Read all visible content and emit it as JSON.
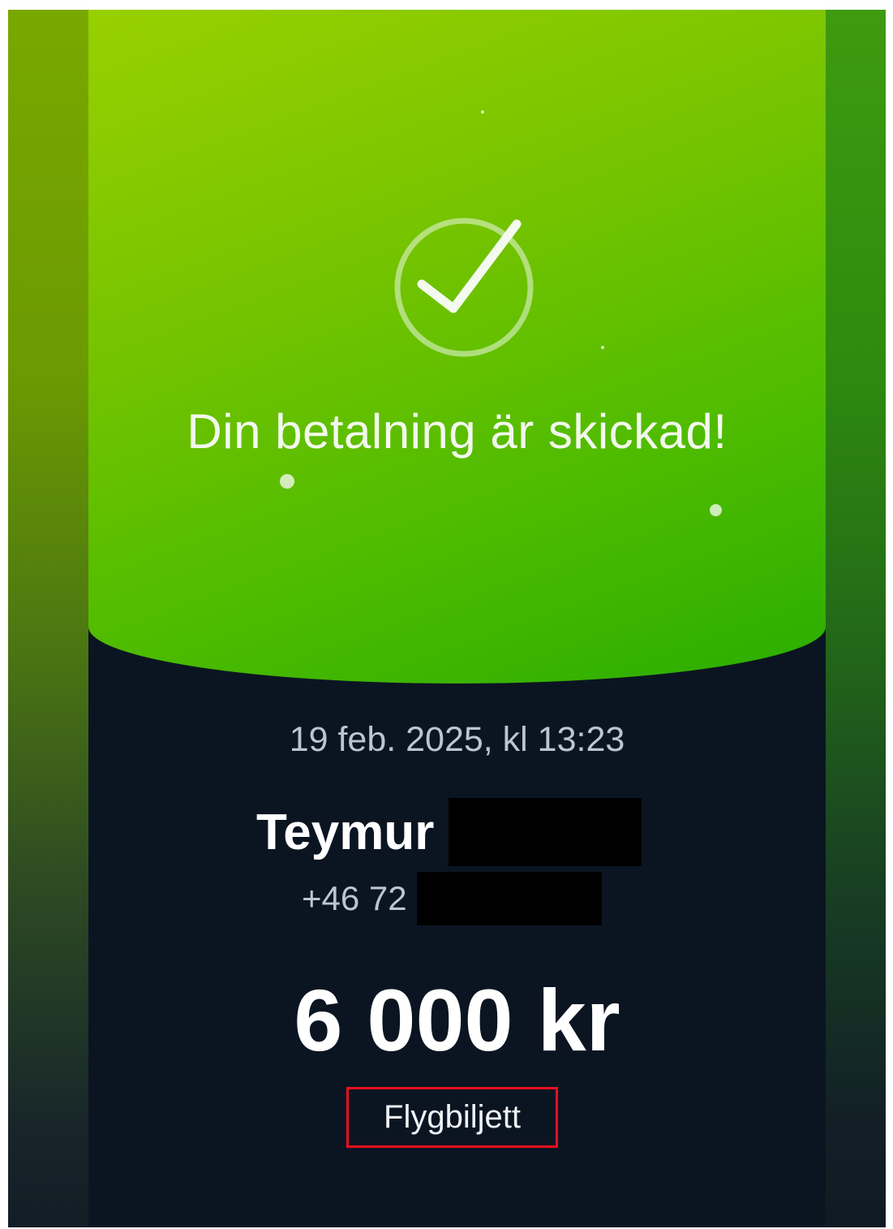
{
  "status": {
    "title": "Din betalning är skickad!",
    "icon": "checkmark-circle-icon"
  },
  "payment": {
    "datetime": "19 feb. 2025, kl 13:23",
    "recipient_first_name": "Teymur",
    "phone_prefix": "+46 72",
    "amount": "6 000 kr",
    "message": "Flygbiljett"
  },
  "colors": {
    "hero_green": "#6cc000",
    "background_dark": "#0b1522",
    "highlight_red": "#e8101c",
    "redaction": "#000000"
  }
}
